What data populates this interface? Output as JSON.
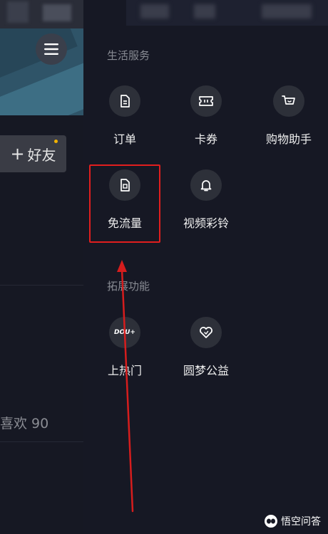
{
  "left_panel": {
    "add_friend_label": "好友",
    "add_friend_prefix": "+",
    "likes_text": "喜欢 90"
  },
  "drawer": {
    "sections": [
      {
        "title": "生活服务",
        "items": [
          {
            "label": "订单",
            "icon": "document-icon"
          },
          {
            "label": "卡券",
            "icon": "ticket-icon"
          },
          {
            "label": "购物助手",
            "icon": "cart-icon"
          },
          {
            "label": "免流量",
            "icon": "sim-card-icon"
          },
          {
            "label": "视频彩铃",
            "icon": "bell-icon"
          }
        ]
      },
      {
        "title": "拓展功能",
        "items": [
          {
            "label": "上热门",
            "icon": "dou-plus-icon",
            "icon_text": "DOU+"
          },
          {
            "label": "圆梦公益",
            "icon": "heart-icon"
          }
        ]
      }
    ]
  },
  "annotation": {
    "highlight_color": "#e11e1e",
    "highlighted_item": "免流量"
  },
  "watermark": {
    "text": "悟空问答"
  },
  "colors": {
    "background": "#161824",
    "icon_circle": "#2d3039",
    "section_title": "#888b93",
    "label": "#eeeeee",
    "notification_dot": "#f2b200"
  }
}
